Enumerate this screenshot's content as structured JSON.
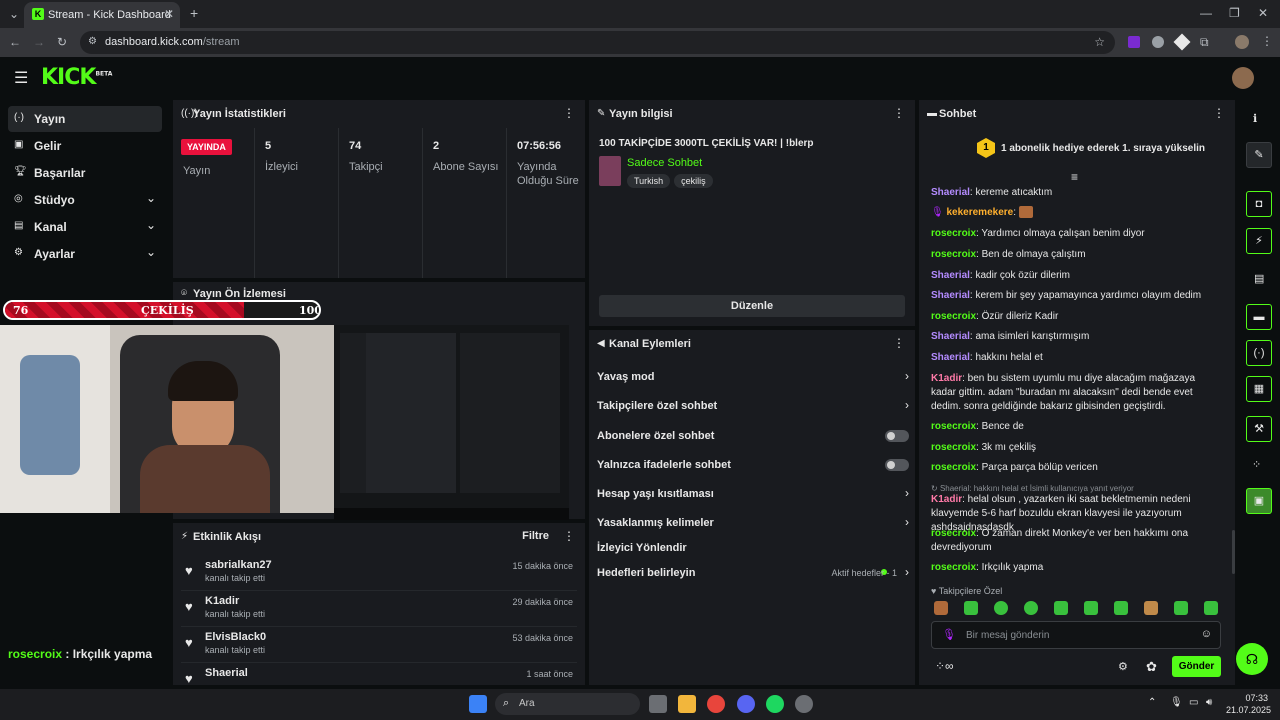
{
  "browser": {
    "tab_title": "Stream - Kick Dashboard",
    "url_host": "dashboard.kick.com",
    "url_path": "/stream"
  },
  "logo": {
    "text": "KICK",
    "tag": "BETA"
  },
  "sidebar": {
    "items": [
      {
        "label": "Yayın",
        "icon": "broadcast-icon"
      },
      {
        "label": "Gelir",
        "icon": "revenue-icon"
      },
      {
        "label": "Başarılar",
        "icon": "trophy-icon"
      },
      {
        "label": "Stüdyo",
        "icon": "studio-icon"
      },
      {
        "label": "Kanal",
        "icon": "channel-icon"
      },
      {
        "label": "Ayarlar",
        "icon": "gear-icon"
      }
    ]
  },
  "stats": {
    "title": "Yayın İstatistikleri",
    "live_badge": "YAYINDA",
    "live_label": "Yayın",
    "viewers_value": "5",
    "viewers_label": "İzleyici",
    "followers_value": "74",
    "followers_label": "Takipçi",
    "subs_value": "2",
    "subs_label": "Abone Sayısı",
    "uptime_value": "07:56:56",
    "uptime_label": "Yayında Olduğu Süre"
  },
  "preview": {
    "title": "Yayın Ön İzlemesi",
    "overlay_left": "76",
    "overlay_center": "ÇEKİLİŞ",
    "overlay_right": "100",
    "chat_overlay_user": "rosecroix",
    "chat_overlay_text": " : Irkçılık yapma"
  },
  "streaminfo": {
    "title": "Yayın bilgisi",
    "stream_title": "100 TAKİPÇİDE 3000TL ÇEKİLİŞ VAR! | !blerp",
    "category": "Sadece Sohbet",
    "tags": [
      "Turkish",
      "çekiliş"
    ],
    "edit_label": "Düzenle"
  },
  "actions": {
    "title": "Kanal Eylemleri",
    "items": [
      {
        "label": "Yavaş mod"
      },
      {
        "label": "Takipçilere özel sohbet"
      },
      {
        "label": "Abonelere özel sohbet"
      },
      {
        "label": "Yalnızca ifadelerle sohbet"
      },
      {
        "label": "Hesap yaşı kısıtlaması"
      },
      {
        "label": "Yasaklanmış kelimeler"
      },
      {
        "label": "İzleyici Yönlendir"
      },
      {
        "label": "Hedefleri belirleyin"
      }
    ],
    "goals_status": "Aktif hedefler - 1"
  },
  "activity": {
    "title": "Etkinlik Akışı",
    "filter_label": "Filtre",
    "items": [
      {
        "user": "sabrialkan27",
        "event": "kanalı takip etti",
        "time": "15 dakika önce"
      },
      {
        "user": "K1adir",
        "event": "kanalı takip etti",
        "time": "29 dakika önce"
      },
      {
        "user": "ElvisBlack0",
        "event": "kanalı takip etti",
        "time": "53 dakika önce"
      },
      {
        "user": "Shaerial",
        "event": "",
        "time": "1 saat önce"
      }
    ]
  },
  "chat": {
    "title": "Sohbet",
    "gift_rank": "1",
    "gift_text": "1 abonelik hediye ederek 1. sıraya yükselin",
    "messages": [
      {
        "user": "Shaerial",
        "text": ": kereme atıcaktım"
      },
      {
        "user": "kekeremekere",
        "text": ":"
      },
      {
        "user": "rosecroix",
        "text": ": Yardımcı olmaya çalışan benim diyor"
      },
      {
        "user": "rosecroix",
        "text": ": Ben de olmaya çalıştım"
      },
      {
        "user": "Shaerial",
        "text": ": kadir çok özür dilerim"
      },
      {
        "user": "Shaerial",
        "text": ": kerem bir şey yapamayınca yardımcı olayım dedim"
      },
      {
        "user": "rosecroix",
        "text": ": Özür dileriz Kadir"
      },
      {
        "user": "Shaerial",
        "text": ": ama isimleri karıştırmışım"
      },
      {
        "user": "Shaerial",
        "text": ": hakkını helal et"
      },
      {
        "user": "K1adir",
        "text": ": ben bu sistem uyumlu mu diye alacağım mağazaya kadar gittim. adam \"buradan mı alacaksın\" dedi bende evet dedim. sonra geldiğinde bakarız gibisinden geçiştirdi."
      },
      {
        "user": "rosecroix",
        "text": ": Bence de"
      },
      {
        "user": "rosecroix",
        "text": ": 3k mı çekiliş"
      },
      {
        "user": "rosecroix",
        "text": ": Parça parça bölüp vericen"
      },
      {
        "reply": "Shaerial: hakkını helal et İsimli kullanıcıya yanıt veriyor",
        "user": "K1adir",
        "text": ": helal olsun , yazarken iki saat bekletmemin nedeni klavyemde 5-6 harf bozuldu ekran klavyesi ile yazıyorum ashdsajdnasdasdk"
      },
      {
        "user": "rosecroix",
        "text": ": O zaman direkt Monkey'e ver ben hakkımı ona devrediyorum"
      },
      {
        "user": "rosecroix",
        "text": ": Irkçılık yapma"
      }
    ],
    "mode_label": "Takipçilere Özel",
    "input_placeholder": "Bir mesaj gönderin",
    "send_label": "Gönder"
  },
  "colors": {
    "accent": "#53fc18",
    "user_purple": "#b48cff",
    "user_green": "#53fc18",
    "user_pink": "#ff7aa8",
    "user_orange": "#ffb02e",
    "live": "#e9113c"
  },
  "taskbar": {
    "search_label": "Ara",
    "time": "07:33",
    "date": "21.07.2025"
  }
}
